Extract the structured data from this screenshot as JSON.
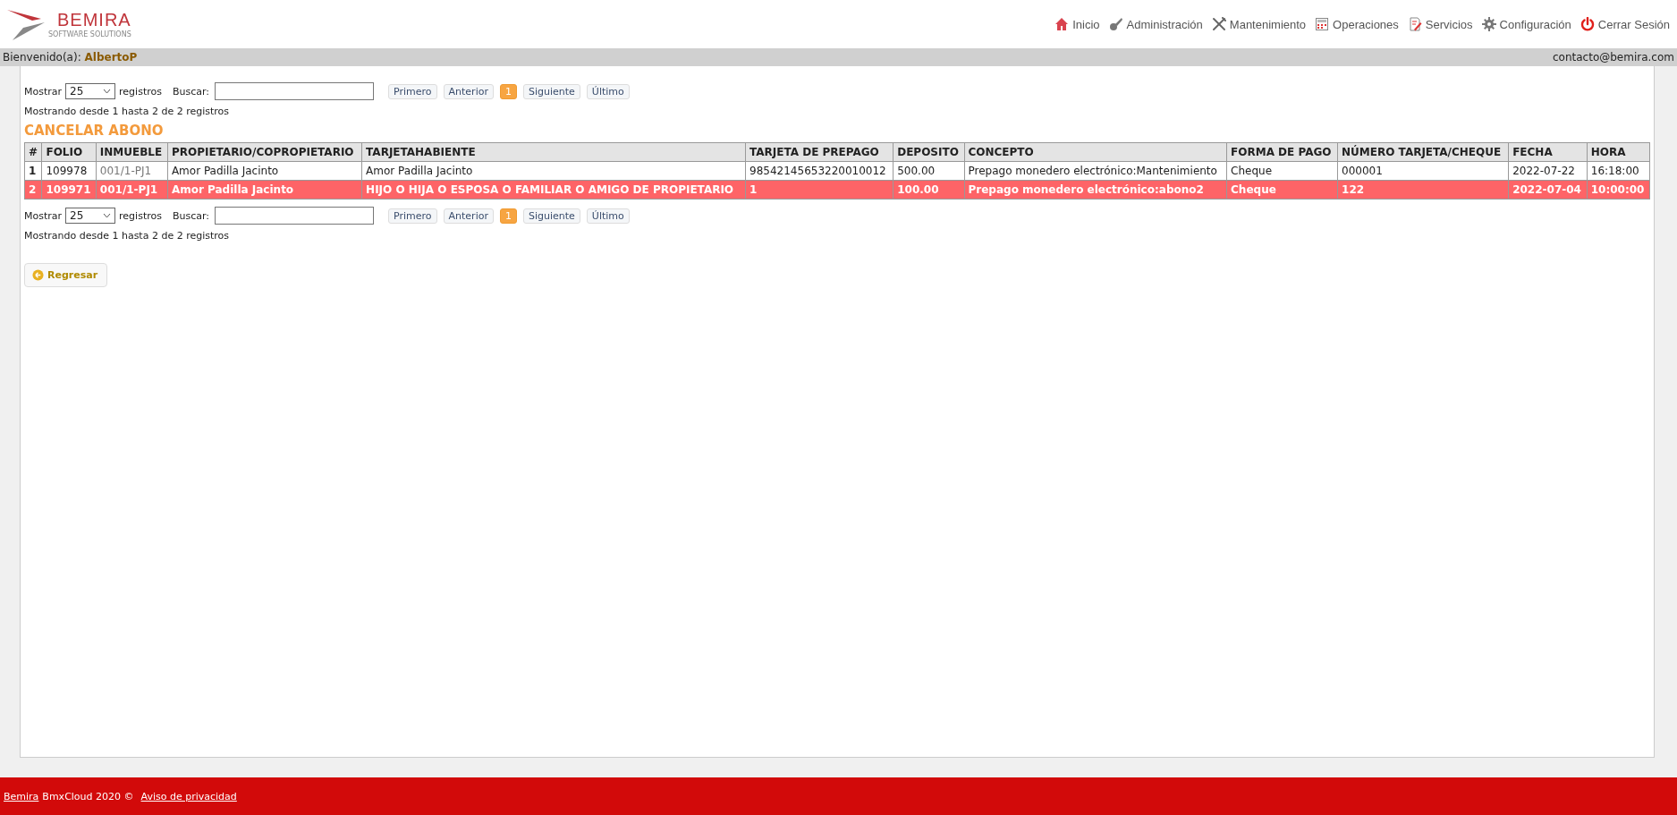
{
  "header": {
    "logo": {
      "name": "BEMIRA",
      "tagline": "SOFTWARE SOLUTIONS"
    },
    "nav": [
      {
        "kind": "home",
        "label": "Inicio"
      },
      {
        "kind": "key",
        "label": "Administración"
      },
      {
        "kind": "tools",
        "label": "Mantenimiento"
      },
      {
        "kind": "calc",
        "label": "Operaciones"
      },
      {
        "kind": "doc",
        "label": "Servicios"
      },
      {
        "kind": "gear",
        "label": "Configuración"
      },
      {
        "kind": "power",
        "label": "Cerrar Sesión"
      }
    ]
  },
  "user_bar": {
    "welcome": "Bienvenido(a):",
    "user": "AlbertoP",
    "email": "contacto@bemira.com"
  },
  "controls_top": {
    "show": "Mostrar",
    "page_size": "25",
    "records": "registros",
    "search": "Buscar:",
    "pager": [
      {
        "label": "Primero",
        "selected": false
      },
      {
        "label": "Anterior",
        "selected": false
      },
      {
        "label": "1",
        "selected": true
      },
      {
        "label": "Siguiente",
        "selected": false
      },
      {
        "label": "Último",
        "selected": false
      }
    ],
    "info": "Mostrando desde 1 hasta 2 de 2 registros"
  },
  "title": "CANCELAR ABONO",
  "table": {
    "columns": [
      "#",
      "FOLIO",
      "INMUEBLE",
      "PROPIETARIO/COPROPIETARIO",
      "TARJETAHABIENTE",
      "TARJETA DE PREPAGO",
      "DEPOSITO",
      "CONCEPTO",
      "FORMA DE PAGO",
      "NÚMERO TARJETA/CHEQUE",
      "FECHA",
      "HORA"
    ],
    "rows": [
      {
        "selected": false,
        "cells": [
          "1",
          "109978",
          "001/1-PJ1",
          "Amor Padilla Jacinto",
          "Amor Padilla Jacinto",
          "98542145653220010012",
          "500.00",
          "Prepago monedero electrónico:Mantenimiento",
          "Cheque",
          "000001",
          "2022-07-22",
          "16:18:00"
        ]
      },
      {
        "selected": true,
        "cells": [
          "2",
          "109971",
          "001/1-PJ1",
          "Amor Padilla Jacinto",
          "HIJO O HIJA O ESPOSA O FAMILIAR O AMIGO DE PROPIETARIO",
          "1",
          "100.00",
          "Prepago monedero electrónico:abono2",
          "Cheque",
          "122",
          "2022-07-04",
          "10:00:00"
        ]
      }
    ]
  },
  "controls_bottom": {
    "show": "Mostrar",
    "page_size": "25",
    "records": "registros",
    "search": "Buscar:",
    "pager": [
      {
        "label": "Primero",
        "selected": false
      },
      {
        "label": "Anterior",
        "selected": false
      },
      {
        "label": "1",
        "selected": true
      },
      {
        "label": "Siguiente",
        "selected": false
      },
      {
        "label": "Último",
        "selected": false
      }
    ],
    "info": "Mostrando desde 1 hasta 2 de 2 registros"
  },
  "back_button": "Regresar",
  "footer": {
    "brand": "Bemira",
    "text": "BmxCloud 2020 ©",
    "privacy": "Aviso de privacidad"
  }
}
